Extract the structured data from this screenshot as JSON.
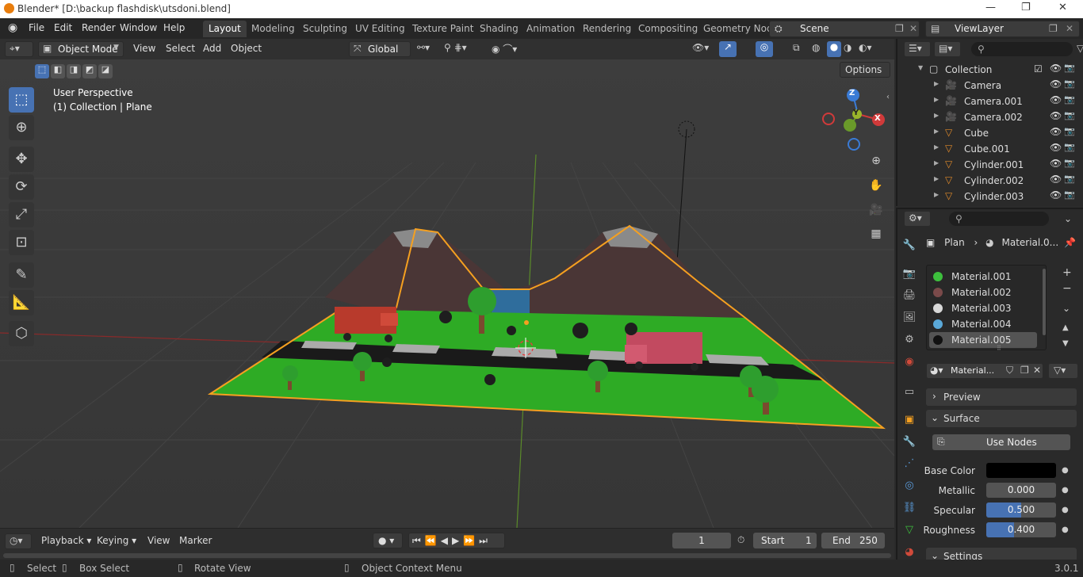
{
  "window": {
    "title": "Blender* [D:\\backup flashdisk\\utsdoni.blend]",
    "minimize": "—",
    "maximize": "❐",
    "close": "✕"
  },
  "menus": [
    "File",
    "Edit",
    "Render",
    "Window",
    "Help"
  ],
  "workspaces": [
    "Layout",
    "Modeling",
    "Sculpting",
    "UV Editing",
    "Texture Paint",
    "Shading",
    "Animation",
    "Rendering",
    "Compositing",
    "Geometry Nod"
  ],
  "active_workspace": "Layout",
  "scene": {
    "name": "Scene",
    "view_layer": "ViewLayer"
  },
  "viewport_header": {
    "mode": "Object Mode",
    "menus": [
      "View",
      "Select",
      "Add",
      "Object"
    ],
    "transform": "Global",
    "options": "Options"
  },
  "viewport": {
    "perspective": "User Perspective",
    "context": "(1) Collection | Plane",
    "gizmo": {
      "z": "Z",
      "y": "Y",
      "x": "X"
    }
  },
  "outliner": {
    "collection": "Collection",
    "items": [
      {
        "name": "Camera",
        "icon": "camera-icon"
      },
      {
        "name": "Camera.001",
        "icon": "camera-icon"
      },
      {
        "name": "Camera.002",
        "icon": "camera-icon"
      },
      {
        "name": "Cube",
        "icon": "mesh-icon"
      },
      {
        "name": "Cube.001",
        "icon": "mesh-icon"
      },
      {
        "name": "Cylinder.001",
        "icon": "mesh-icon"
      },
      {
        "name": "Cylinder.002",
        "icon": "mesh-icon"
      },
      {
        "name": "Cylinder.003",
        "icon": "mesh-icon"
      }
    ]
  },
  "properties": {
    "breadcrumb": {
      "object": "Plan",
      "material": "Material.0..."
    },
    "materials": [
      {
        "name": "Material.001",
        "color": "#3dbf3d"
      },
      {
        "name": "Material.002",
        "color": "#7a4a4a"
      },
      {
        "name": "Material.003",
        "color": "#d8d8d8"
      },
      {
        "name": "Material.004",
        "color": "#5aa8d8"
      },
      {
        "name": "Material.005",
        "color": "#111111"
      }
    ],
    "selected_material_index": 4,
    "material_field": "Material...",
    "panels": {
      "preview": "Preview",
      "surface": "Surface",
      "settings": "Settings"
    },
    "use_nodes": "Use Nodes",
    "fields": [
      {
        "label": "Base Color",
        "value": "",
        "color": "#000000"
      },
      {
        "label": "Metallic",
        "value": "0.000",
        "fraction": 0
      },
      {
        "label": "Specular",
        "value": "0.500",
        "fraction": 0.5
      },
      {
        "label": "Roughness",
        "value": "0.400",
        "fraction": 0.4
      }
    ]
  },
  "timeline": {
    "menus": [
      "Playback",
      "Keying",
      "View",
      "Marker"
    ],
    "current_frame": "1",
    "start_label": "Start",
    "start": "1",
    "end_label": "End",
    "end": "250"
  },
  "statusbar": {
    "select": "Select",
    "box_select": "Box Select",
    "rotate": "Rotate View",
    "context_menu": "Object Context Menu",
    "version": "3.0.1"
  },
  "colors": {
    "accent": "#4772b3",
    "selection_outline": "#f5a020",
    "ground": "#2eab25"
  }
}
